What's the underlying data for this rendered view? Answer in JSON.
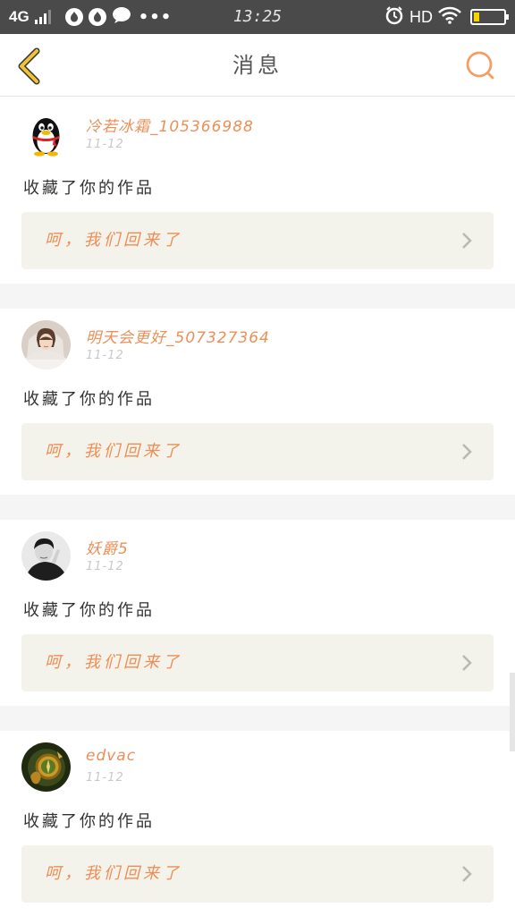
{
  "status_bar": {
    "network": "4G",
    "time": "13:25",
    "hd": "HD",
    "dots": "•••"
  },
  "header": {
    "title": "消息"
  },
  "messages": [
    {
      "user": "冷若冰霜_105366988",
      "date": "11-12",
      "action": "收藏了你的作品",
      "work_title": "呵，我们回来了",
      "avatar": "qq-penguin-avatar"
    },
    {
      "user": "明天会更好_507327364",
      "date": "11-12",
      "action": "收藏了你的作品",
      "work_title": "呵，我们回来了",
      "avatar": "bride-photo-avatar"
    },
    {
      "user": "妖爵5",
      "date": "11-12",
      "action": "收藏了你的作品",
      "work_title": "呵，我们回来了",
      "avatar": "monochrome-portrait-avatar"
    },
    {
      "user": "edvac",
      "date": "11-12",
      "action": "收藏了你的作品",
      "work_title": "呵，我们回来了",
      "avatar": "gold-compass-avatar"
    }
  ],
  "colors": {
    "status_bar_bg": "#4a4a4a",
    "accent_orange": "#ec8f57",
    "back_arrow_yellow": "#f0c23a",
    "work_box_bg": "#f3f3eb",
    "separator": "#f5f5f5"
  }
}
